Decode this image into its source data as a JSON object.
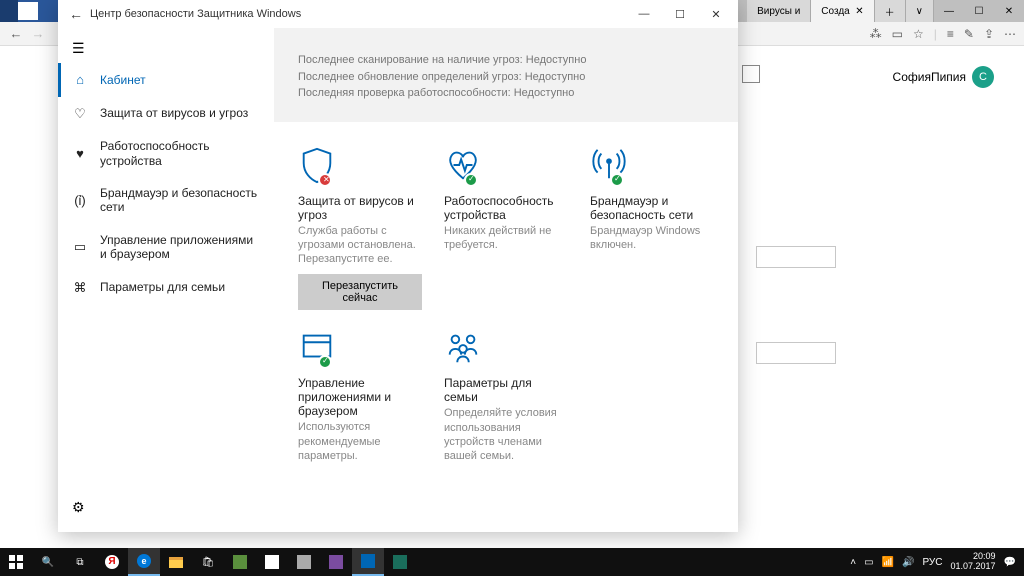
{
  "browser": {
    "tabs": [
      {
        "label": "Вирусы и"
      },
      {
        "label": "Созда",
        "active": true
      }
    ],
    "user_name": "СофияПипия",
    "avatar_initial": "С"
  },
  "defender": {
    "title": "Центр безопасности Защитника Windows",
    "sidebar": {
      "items": [
        {
          "label": "Кабинет",
          "selected": true
        },
        {
          "label": "Защита от вирусов и угроз"
        },
        {
          "label": "Работоспособность устройства"
        },
        {
          "label": "Брандмауэр и безопасность сети"
        },
        {
          "label": "Управление приложениями и браузером"
        },
        {
          "label": "Параметры для семьи"
        }
      ]
    },
    "status": {
      "line1": "Последнее сканирование на наличие угроз: Недоступно",
      "line2": "Последнее обновление определений угроз: Недоступно",
      "line3": "Последняя проверка работоспособности: Недоступно"
    },
    "cards": [
      {
        "title": "Защита от вирусов и угроз",
        "desc": "Служба работы с угрозами остановлена. Перезапустите ее.",
        "badge": "err",
        "button": "Перезапустить сейчас"
      },
      {
        "title": "Работоспособность устройства",
        "desc": "Никаких действий не требуется.",
        "badge": "ok"
      },
      {
        "title": "Брандмауэр и безопасность сети",
        "desc": "Брандмауэр Windows включен.",
        "badge": "ok"
      },
      {
        "title": "Управление приложениями и браузером",
        "desc": "Используются рекомендуемые параметры.",
        "badge": "ok"
      },
      {
        "title": "Параметры для семьи",
        "desc": "Определяйте условия использования устройств членами вашей семьи."
      }
    ]
  },
  "taskbar": {
    "time": "20:09",
    "date": "01.07.2017",
    "lang": "РУС"
  }
}
